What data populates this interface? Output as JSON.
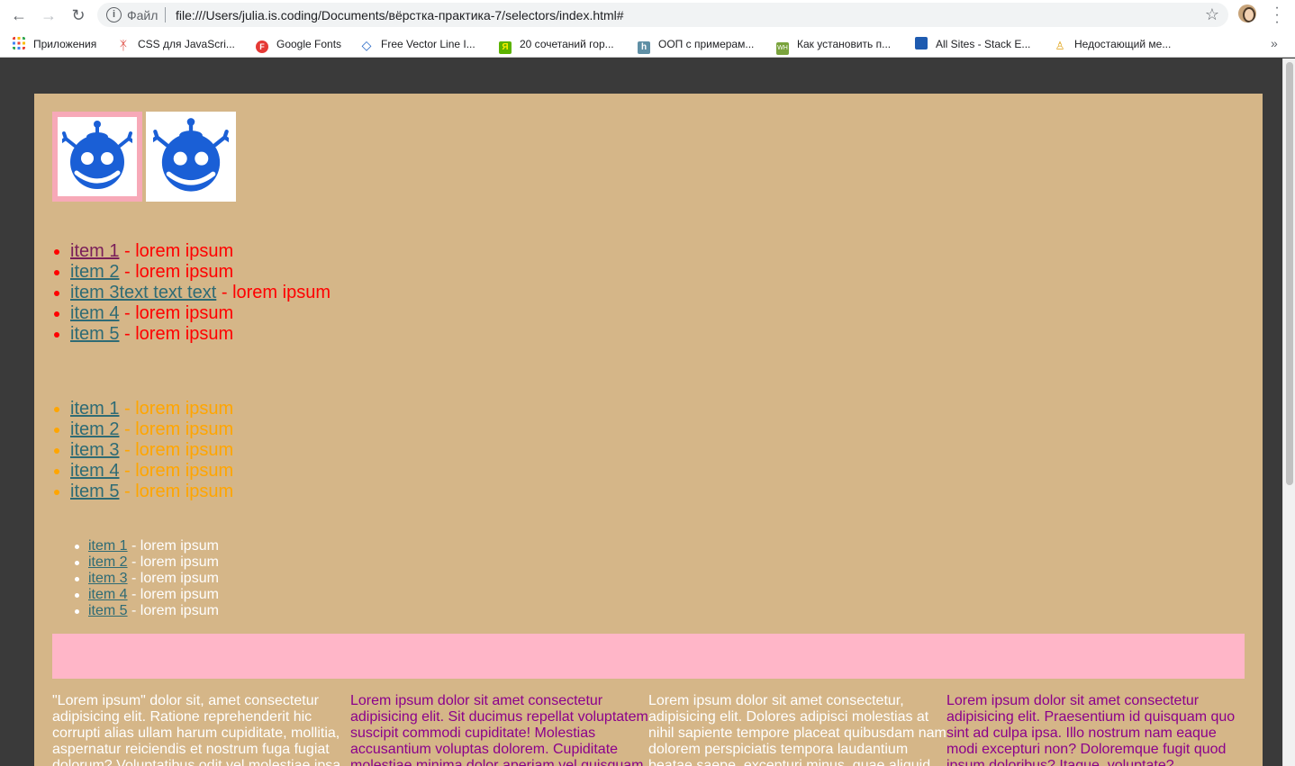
{
  "browser": {
    "omnibox": {
      "scheme_label": "Файл",
      "url": "file:///Users/julia.is.coding/Documents/вёрстка-практика-7/selectors/index.html#"
    },
    "bookmarks": [
      {
        "label": "Приложения",
        "icon": "apps-grid-icon",
        "color": "#ea4335"
      },
      {
        "label": "CSS для JavaScri...",
        "icon": "figure-icon",
        "color": "#d93025"
      },
      {
        "label": "Google Fonts",
        "icon": "google-fonts-icon",
        "color": "#e53935"
      },
      {
        "label": "Free Vector Line I...",
        "icon": "diamond-icon",
        "color": "#1e62c4"
      },
      {
        "label": "20 сочетаний гор...",
        "icon": "yandex-icon",
        "color": "#5cb300"
      },
      {
        "label": "ООП с примерам...",
        "icon": "habr-icon",
        "color": "#5f8fa5"
      },
      {
        "label": "Как установить п...",
        "icon": "wh-icon",
        "color": "#7aa33c"
      },
      {
        "label": "All Sites - Stack E...",
        "icon": "stackexchange-icon",
        "color": "#1e5bb0"
      },
      {
        "label": "Недостающий ме...",
        "icon": "person-icon",
        "color": "#e0a010"
      }
    ]
  },
  "page": {
    "colors": {
      "content_bg": "#d5b688",
      "outer_bg": "#3a3a3a",
      "pink": "#ffb6c8",
      "link": "#2e6b75",
      "visited_link": "#7a1f5a"
    },
    "images": [
      {
        "icon": "robot-logo-icon",
        "bordered": true
      },
      {
        "icon": "robot-logo-icon",
        "bordered": false
      }
    ],
    "list1": [
      {
        "link": "item 1",
        "text": " - lorem ipsum"
      },
      {
        "link": "item 2",
        "text": " - lorem ipsum"
      },
      {
        "link": "item 3text text text",
        "text": " - lorem ipsum"
      },
      {
        "link": "item 4",
        "text": " - lorem ipsum"
      },
      {
        "link": "item 5",
        "text": " - lorem ipsum"
      }
    ],
    "list2": [
      {
        "link": "item 1",
        "text": " - lorem ipsum"
      },
      {
        "link": "item 2",
        "text": " - lorem ipsum"
      },
      {
        "link": "item 3",
        "text": " - lorem ipsum"
      },
      {
        "link": "item 4",
        "text": " - lorem ipsum"
      },
      {
        "link": "item 5",
        "text": " - lorem ipsum"
      }
    ],
    "list3": [
      {
        "link": "item 1",
        "text": " - lorem ipsum"
      },
      {
        "link": "item 2",
        "text": " - lorem ipsum"
      },
      {
        "link": "item 3",
        "text": " - lorem ipsum"
      },
      {
        "link": "item 4",
        "text": " - lorem ipsum"
      },
      {
        "link": "item 5",
        "text": " - lorem ipsum"
      }
    ],
    "columns": [
      "\"Lorem ipsum\" dolor sit, amet consectetur adipisicing elit. Ratione reprehenderit hic corrupti alias ullam harum cupiditate, mollitia, aspernatur reiciendis et nostrum fuga fugiat dolorum? Voluptatibus odit vel molestiae ipsa.",
      "Lorem ipsum dolor sit amet consectetur adipisicing elit. Sit ducimus repellat voluptatem suscipit commodi cupiditate! Molestias accusantium voluptas dolorem. Cupiditate molestiae minima dolor aperiam vel quisquam.",
      "Lorem ipsum dolor sit amet consectetur, adipisicing elit. Dolores adipisci molestias at nihil sapiente tempore placeat quibusdam nam dolorem perspiciatis tempora laudantium beatae saepe, excepturi minus, quae aliquid.",
      "Lorem ipsum dolor sit amet consectetur adipisicing elit. Praesentium id quisquam quo sint ad culpa ipsa. Illo nostrum nam eaque modi excepturi non? Doloremque fugit quod ipsum doloribus? Itaque, voluptate?"
    ]
  }
}
